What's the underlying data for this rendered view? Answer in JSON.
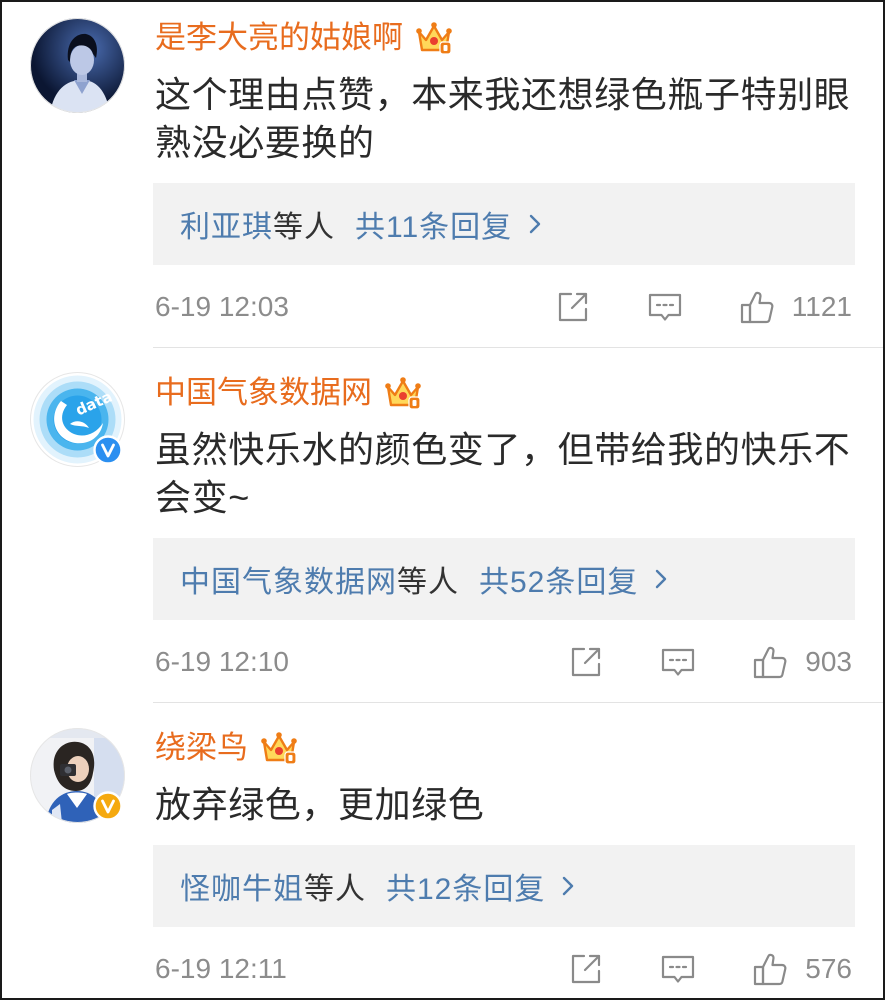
{
  "comments": [
    {
      "username": "是李大亮的姑娘啊",
      "text": "这个理由点赞，本来我还想绿色瓶子特别眼熟没必要换的",
      "reply_names": "利亚琪",
      "reply_suffix": "等人",
      "reply_count": "共11条回复",
      "time": "6-19 12:03",
      "likes": "1121",
      "verified": false
    },
    {
      "username": "中国气象数据网",
      "text": "虽然快乐水的颜色变了，但带给我的快乐不会变~",
      "avatar_logo_text": "data",
      "reply_names": "中国气象数据网",
      "reply_suffix": "等人",
      "reply_count": "共52条回复",
      "time": "6-19 12:10",
      "likes": "903",
      "verified": true,
      "verified_color": "#2b8ff0"
    },
    {
      "username": "绕梁鸟",
      "text": "放弃绿色，更加绿色",
      "reply_names": "怪咖牛姐",
      "reply_suffix": "等人",
      "reply_count": "共12条回复",
      "time": "6-19 12:11",
      "likes": "576",
      "verified": true,
      "verified_color": "#f5a90f"
    }
  ],
  "icons": {
    "member_badge": "crown-badge-icon",
    "verified": "verified-icon",
    "reply_more": "chevron-right-icon",
    "share": "share-icon",
    "comment": "comment-icon",
    "like": "like-icon"
  },
  "colors": {
    "username": "#e86c1e",
    "text": "#2a2a2a",
    "reply_link": "#4e7cae",
    "reply_box": "#f2f2f2",
    "meta": "#8c8c8c",
    "divider": "#e3e3e3"
  }
}
